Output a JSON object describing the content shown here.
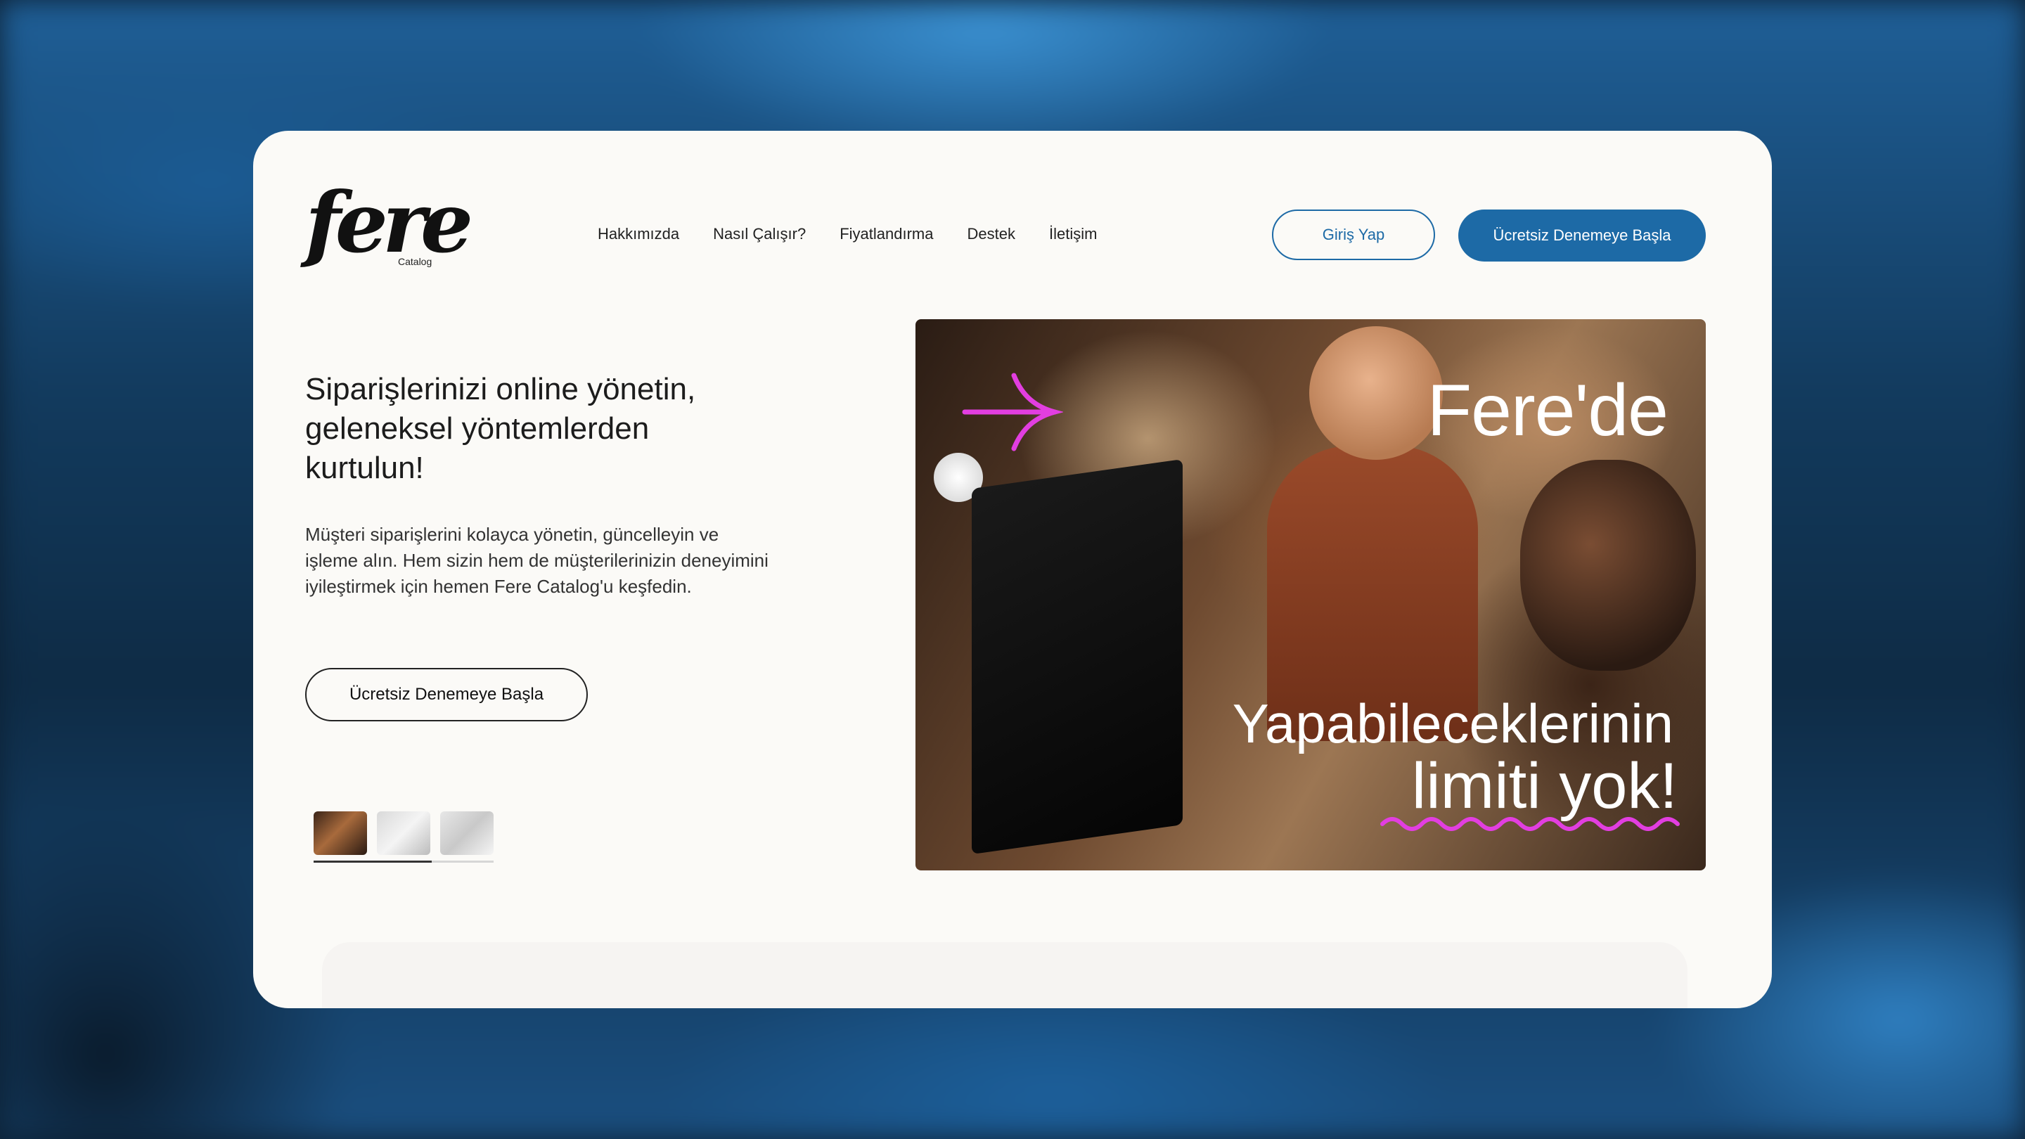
{
  "brand": {
    "logo_text": "fere",
    "logo_subtext": "Catalog"
  },
  "nav": {
    "items": [
      {
        "label": "Hakkımızda"
      },
      {
        "label": "Nasıl Çalışır?"
      },
      {
        "label": "Fiyatlandırma"
      },
      {
        "label": "Destek"
      },
      {
        "label": "İletişim"
      }
    ],
    "login_label": "Giriş Yap",
    "trial_label": "Ücretsiz Denemeye Başla"
  },
  "hero": {
    "title": "Siparişlerinizi online yönetin, geleneksel yöntemlerden kurtulun!",
    "description": "Müşteri siparişlerini kolayca yönetin, güncelleyin ve işleme alın. Hem sizin hem de müşterilerinizin deneyimini iyileştirmek için hemen Fere Catalog'u keşfedin.",
    "cta_label": "Ücretsiz Denemeye Başla",
    "image_text_top": "Fere'de",
    "image_text_middle": "Yapabileceklerinin",
    "image_text_bottom": "limiti yok!",
    "slides_count": 3,
    "active_slide": 1
  },
  "colors": {
    "accent": "#1d6aa6",
    "highlight": "#e23ee0",
    "card_bg": "#fbfaf7"
  }
}
